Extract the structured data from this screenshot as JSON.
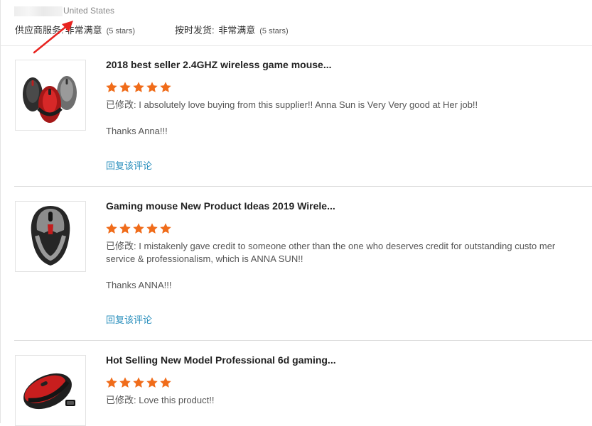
{
  "header": {
    "country": "United States",
    "supplier_service_label": "供应商服务:",
    "supplier_service_value": "非常满意",
    "supplier_service_stars": "(5 stars)",
    "shipping_label": "按时发货:",
    "shipping_value": "非常满意",
    "shipping_stars": "(5 stars)"
  },
  "colors": {
    "star": "#f06c1a",
    "link": "#2a8fbd",
    "annotation_arrow": "#e8231f"
  },
  "reviews": [
    {
      "product_title": "2018 best seller 2.4GHZ wireless game mouse...",
      "rating": 5,
      "comment": "已修改: I absolutely love buying from this supplier!! Anna Sun is Very Very good at Her job!!",
      "thanks": "Thanks Anna!!!",
      "reply_label": "回复该评论",
      "thumbnail_icon": "mouse-trio-icon"
    },
    {
      "product_title": "Gaming mouse New Product Ideas 2019 Wirele...",
      "rating": 5,
      "comment": "已修改: I mistakenly gave credit to someone other than the one who deserves credit for outstanding custo mer service & professionalism, which is ANNA SUN!!",
      "thanks": "Thanks ANNA!!!",
      "reply_label": "回复该评论",
      "thumbnail_icon": "gray-mouse-icon"
    },
    {
      "product_title": "Hot Selling New Model Professional 6d gaming...",
      "rating": 5,
      "comment": "已修改: Love this product!!",
      "thumbnail_icon": "red-mouse-icon"
    }
  ]
}
